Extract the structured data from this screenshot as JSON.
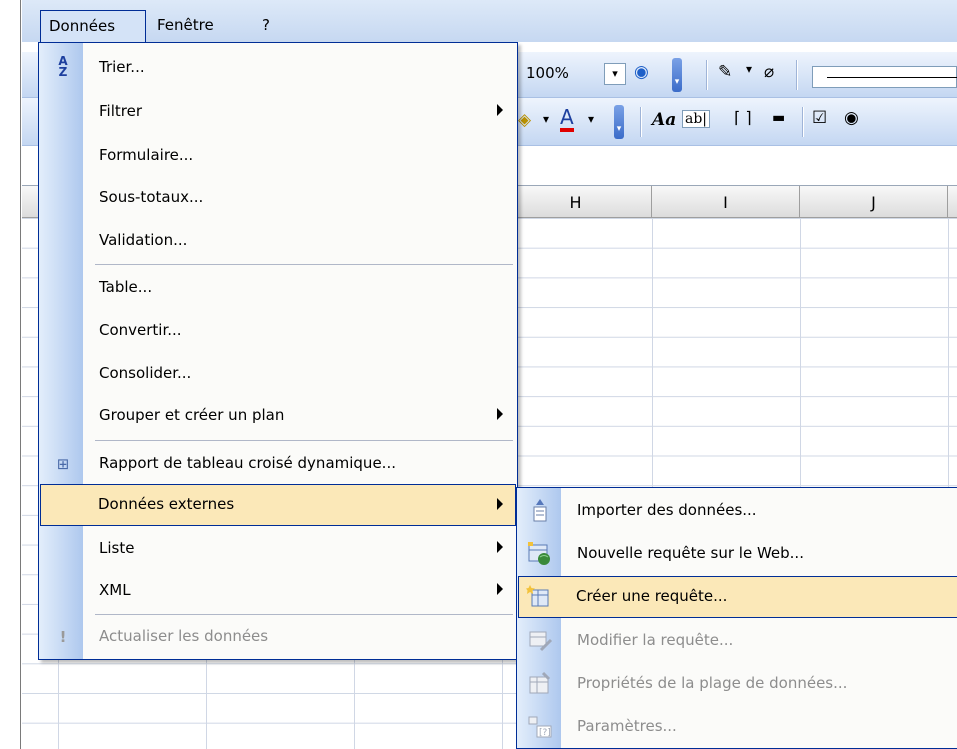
{
  "menubar": {
    "items": [
      {
        "label": "Données"
      },
      {
        "label": "Fenêtre"
      },
      {
        "label": "?"
      }
    ]
  },
  "toolbar": {
    "zoom": "100%"
  },
  "columns": [
    "H",
    "I",
    "J"
  ],
  "menu": {
    "items": [
      {
        "label": "Trier...",
        "icon": "sort-az-icon"
      },
      {
        "label": "Filtrer",
        "submenu": true
      },
      {
        "label": "Formulaire..."
      },
      {
        "label": "Sous-totaux..."
      },
      {
        "label": "Validation..."
      },
      {
        "label": "Table..."
      },
      {
        "label": "Convertir..."
      },
      {
        "label": "Consolider..."
      },
      {
        "label": "Grouper et créer un plan",
        "submenu": true
      },
      {
        "label": "Rapport de tableau croisé dynamique...",
        "icon": "pivot-table-icon"
      },
      {
        "label": "Données externes",
        "submenu": true,
        "highlighted": true
      },
      {
        "label": "Liste",
        "submenu": true
      },
      {
        "label": "XML",
        "submenu": true
      },
      {
        "label": "Actualiser les données",
        "icon": "refresh-exclamation-icon",
        "disabled": true
      }
    ]
  },
  "submenu": {
    "items": [
      {
        "label": "Importer des données...",
        "icon": "import-data-icon"
      },
      {
        "label": "Nouvelle requête sur le Web...",
        "icon": "web-query-icon"
      },
      {
        "label": "Créer une requête...",
        "icon": "new-query-icon",
        "highlighted": true
      },
      {
        "label": "Modifier la requête...",
        "icon": "edit-query-icon",
        "disabled": true
      },
      {
        "label": "Propriétés de la plage de données...",
        "icon": "range-properties-icon",
        "disabled": true
      },
      {
        "label": "Paramètres...",
        "icon": "parameters-icon",
        "disabled": true
      }
    ]
  },
  "colors": {
    "highlight": "#fbe8b8",
    "menu_border": "#002d96",
    "disabled_text": "#8d8d8d"
  }
}
